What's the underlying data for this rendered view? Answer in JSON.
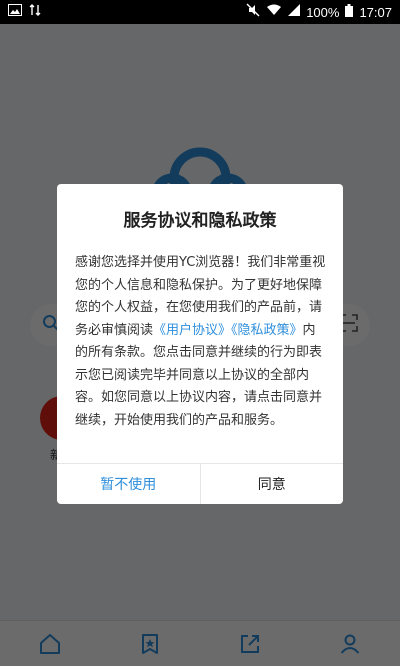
{
  "status_bar": {
    "battery_percent": "100%",
    "time": "17:07"
  },
  "home": {
    "quick_links": [
      {
        "label": "新浪"
      }
    ]
  },
  "dialog": {
    "title": "服务协议和隐私政策",
    "body_intro": "感谢您选择并使用YC浏览器！我们非常重视您的个人信息和隐私保护。为了更好地保障您的个人权益，在您使用我们的产品前，请务必审慎阅读",
    "link_user_agreement": "《用户协议》",
    "link_privacy_policy": "《隐私政策》",
    "body_outro": "内的所有条款。您点击同意并继续的行为即表示您已阅读完毕并同意以上协议的全部内容。如您同意以上协议内容，请点击同意并继续，开始使用我们的产品和服务。",
    "decline_label": "暂不使用",
    "agree_label": "同意"
  },
  "colors": {
    "accent": "#2f8fdc",
    "overlay": "rgba(0,0,0,0.58)",
    "brand_red": "#e2231a"
  }
}
